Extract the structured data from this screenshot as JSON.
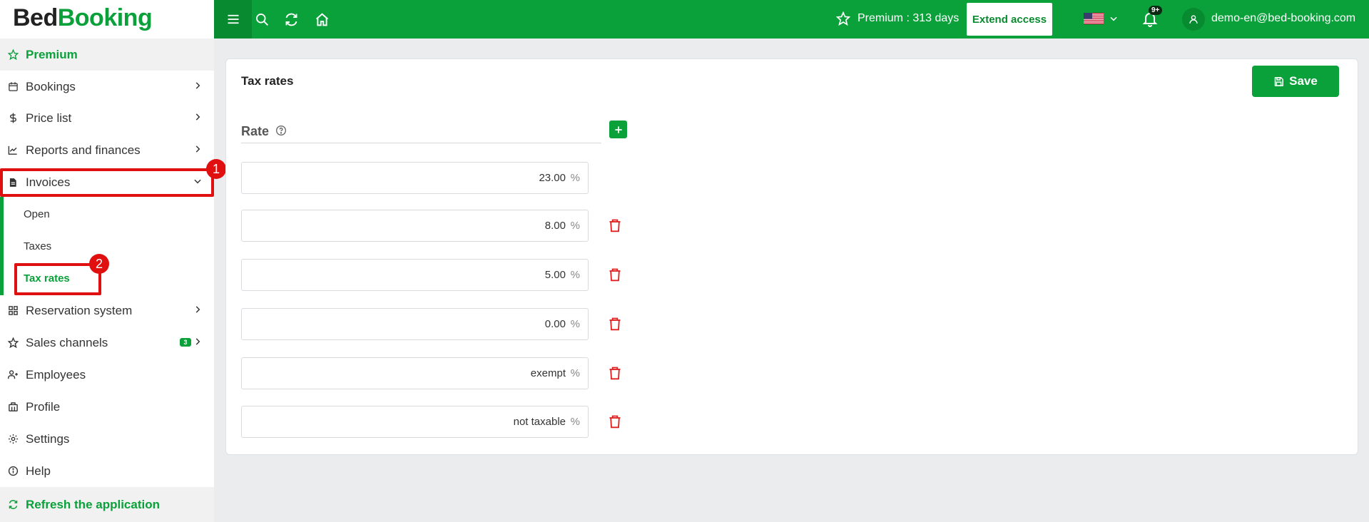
{
  "brand": {
    "part1": "Bed",
    "part2": "Booking"
  },
  "sidebar": {
    "premium": "Premium",
    "items": [
      {
        "label": "Bookings",
        "icon": "calendar-icon"
      },
      {
        "label": "Price list",
        "icon": "dollar-icon"
      },
      {
        "label": "Reports and finances",
        "icon": "chart-icon"
      },
      {
        "label": "Invoices",
        "icon": "invoice-icon"
      },
      {
        "label": "Reservation system",
        "icon": "grid-icon"
      },
      {
        "label": "Sales channels",
        "icon": "star-icon",
        "badge": "3"
      },
      {
        "label": "Employees",
        "icon": "user-plus-icon"
      },
      {
        "label": "Profile",
        "icon": "building-icon"
      },
      {
        "label": "Settings",
        "icon": "gear-icon"
      },
      {
        "label": "Help",
        "icon": "info-icon"
      }
    ],
    "submenu": [
      {
        "label": "Open"
      },
      {
        "label": "Taxes"
      },
      {
        "label": "Tax rates"
      }
    ],
    "refresh": "Refresh the application"
  },
  "callouts": {
    "one": "1",
    "two": "2"
  },
  "topbar": {
    "premium_text": "Premium : 313 days",
    "extend_label": "Extend access",
    "notif_badge": "9+",
    "user_email": "demo-en@bed-booking.com",
    "language": "English (US)"
  },
  "main": {
    "title": "Tax rates",
    "save_label": "Save",
    "rate_header": "Rate",
    "unit": "%",
    "rates": [
      "23.00",
      "8.00",
      "5.00",
      "0.00",
      "exempt",
      "not taxable"
    ]
  },
  "colors": {
    "accent": "#0aa13a",
    "accent_dark": "#078a30",
    "callout": "#e01010",
    "danger": "#e02020"
  }
}
